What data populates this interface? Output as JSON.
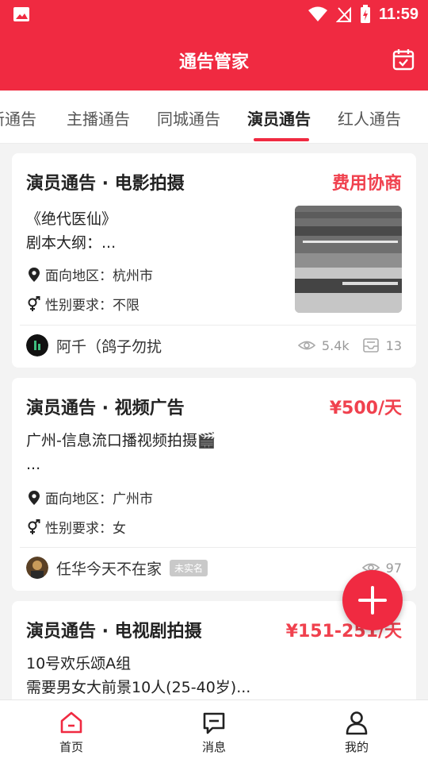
{
  "statusbar": {
    "time": "11:59"
  },
  "header": {
    "title": "通告管家"
  },
  "tabs": [
    {
      "label": "新通告"
    },
    {
      "label": "主播通告"
    },
    {
      "label": "同城通告"
    },
    {
      "label": "演员通告"
    },
    {
      "label": "红人通告"
    }
  ],
  "cards": [
    {
      "title": "演员通告 · 电影拍摄",
      "price": "费用协商",
      "desc1": "《绝代医仙》",
      "desc2": "剧本大纲：...",
      "location_label": "面向地区：杭州市",
      "gender_label": "性别要求：不限",
      "author": "阿千（鸽子勿扰",
      "views": "5.4k",
      "messages": "13"
    },
    {
      "title": "演员通告 · 视频广告",
      "price": "¥500/天",
      "desc1": "广州-信息流口播视频拍摄🎬",
      "desc2": "...",
      "location_label": "面向地区：广州市",
      "gender_label": "性别要求：女",
      "author": "任华今天不在家",
      "badge": "未实名",
      "views": "97"
    },
    {
      "title": "演员通告 · 电视剧拍摄",
      "price": "¥151-251/天",
      "desc1": "10号欢乐颂A组",
      "desc2": "需要男女大前景10人(25-40岁)..."
    }
  ],
  "bottomnav": {
    "home": "首页",
    "messages": "消息",
    "mine": "我的"
  },
  "colors": {
    "brand": "#f02a41",
    "price": "#f0414e"
  }
}
